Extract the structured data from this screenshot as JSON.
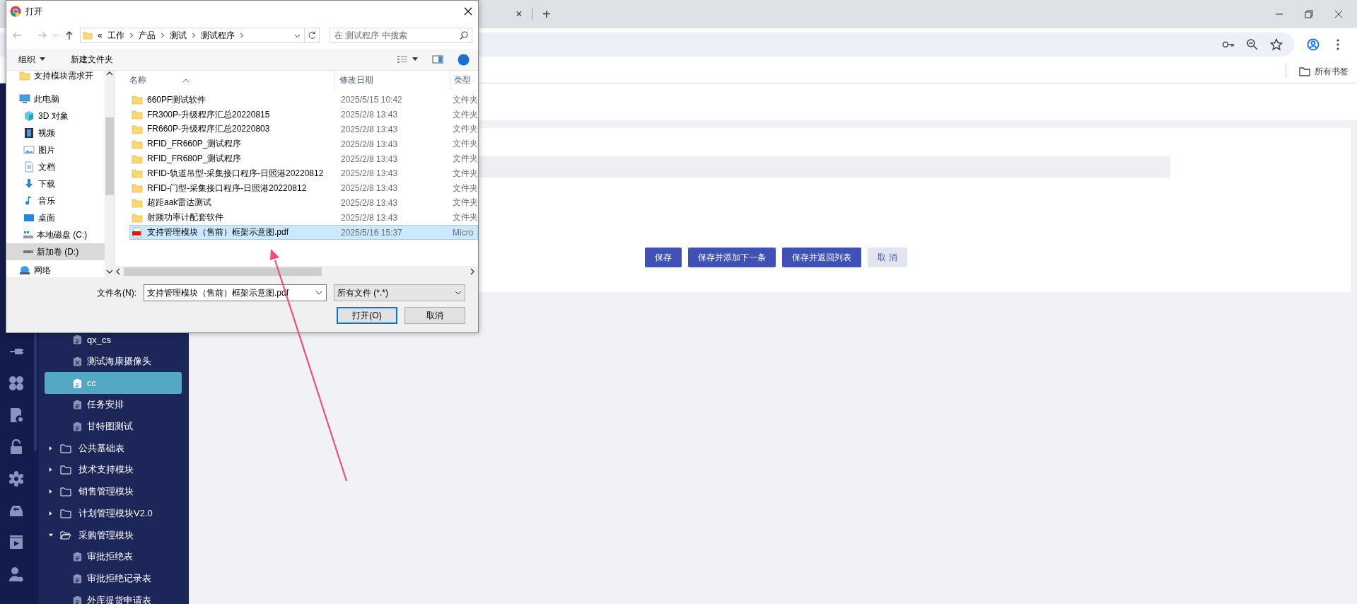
{
  "browser": {
    "tab_close": "×",
    "new_tab": "+",
    "bookmarks": "所有书签"
  },
  "dialog": {
    "title": "打开",
    "path": [
      "«",
      "工作",
      "产品",
      "测试",
      "测试程序"
    ],
    "search": {
      "placeholder": "在 测试程序 中搜索"
    },
    "toolbar": {
      "organize": "组织",
      "new_folder": "新建文件夹"
    },
    "nav": [
      {
        "label": "支持模块需求开",
        "kind": "folder",
        "selected": false
      },
      {
        "label": "此电脑",
        "kind": "pc",
        "selected": false,
        "children": [
          {
            "label": "3D 对象",
            "kind": "cube",
            "selected": false
          },
          {
            "label": "视频",
            "kind": "video",
            "selected": false
          },
          {
            "label": "图片",
            "kind": "pictures",
            "selected": false
          },
          {
            "label": "文档",
            "kind": "docs",
            "selected": false
          },
          {
            "label": "下载",
            "kind": "downloads",
            "selected": false
          },
          {
            "label": "音乐",
            "kind": "music",
            "selected": false
          },
          {
            "label": "桌面",
            "kind": "desktop",
            "selected": false
          },
          {
            "label": "本地磁盘 (C:)",
            "kind": "system-drive",
            "selected": false
          },
          {
            "label": "新加卷 (D:)",
            "kind": "drive",
            "selected": true
          }
        ]
      },
      {
        "label": "网络",
        "kind": "network",
        "selected": false
      }
    ],
    "columns": [
      "名称",
      "修改日期",
      "类型"
    ],
    "files": [
      {
        "name": "660PF测试软件",
        "date": "2025/5/15 10:42",
        "type": "文件夹",
        "kind": "folder",
        "selected": false
      },
      {
        "name": "FR300P-升级程序汇总20220815",
        "date": "2025/2/8 13:43",
        "type": "文件夹",
        "kind": "folder",
        "selected": false
      },
      {
        "name": "FR660P-升级程序汇总20220803",
        "date": "2025/2/8 13:43",
        "type": "文件夹",
        "kind": "folder",
        "selected": false
      },
      {
        "name": "RFID_FR660P_测试程序",
        "date": "2025/2/8 13:43",
        "type": "文件夹",
        "kind": "folder",
        "selected": false
      },
      {
        "name": "RFID_FR680P_测试程序",
        "date": "2025/2/8 13:43",
        "type": "文件夹",
        "kind": "folder",
        "selected": false
      },
      {
        "name": "RFID-轨道吊型-采集接口程序-日照港20220812",
        "date": "2025/2/8 13:43",
        "type": "文件夹",
        "kind": "folder",
        "selected": false
      },
      {
        "name": "RFID-门型-采集接口程序-日照港20220812",
        "date": "2025/2/8 13:43",
        "type": "文件夹",
        "kind": "folder",
        "selected": false
      },
      {
        "name": "超距aak雷达测试",
        "date": "2025/2/8 13:43",
        "type": "文件夹",
        "kind": "folder",
        "selected": false
      },
      {
        "name": "射频功率计配套软件",
        "date": "2025/2/8 13:43",
        "type": "文件夹",
        "kind": "folder",
        "selected": false
      },
      {
        "name": "支持管理模块（售前）框架示意图.pdf",
        "date": "2025/5/16 15:37",
        "type": "Micro",
        "kind": "pdf",
        "selected": true
      }
    ],
    "filename": {
      "label": "文件名(N):",
      "value": "支持管理模块（售前）框架示意图.pdf"
    },
    "filter": "所有文件 (*.*)",
    "buttons": [
      {
        "label": "打开(O)",
        "kind": "default"
      },
      {
        "label": "取消",
        "kind": "normal"
      }
    ]
  },
  "tree": [
    {
      "children": [
        {
          "label": "qx_cs",
          "kind": "doc",
          "selected": false
        },
        {
          "label": "测试海康摄像头",
          "kind": "tool",
          "selected": false
        },
        {
          "label": "cc",
          "kind": "doc",
          "selected": true
        },
        {
          "label": "任务安排",
          "kind": "doc",
          "selected": false
        },
        {
          "label": "甘特图测试",
          "kind": "doc",
          "selected": false
        }
      ]
    },
    {
      "label": "公共基础表",
      "expanded": false
    },
    {
      "label": "技术支持模块",
      "expanded": false
    },
    {
      "label": "销售管理模块",
      "expanded": false
    },
    {
      "label": "计划管理模块V2.0",
      "expanded": false
    },
    {
      "label": "采购管理模块",
      "expanded": true,
      "children": [
        {
          "label": "审批拒绝表",
          "kind": "doc",
          "selected": false
        },
        {
          "label": "审批拒绝记录表",
          "kind": "doc",
          "selected": false
        },
        {
          "label": "外库提货申请表",
          "kind": "doc",
          "selected": false
        }
      ]
    }
  ],
  "form": {
    "buttons": [
      {
        "label": "保存",
        "kind": "primary"
      },
      {
        "label": "保存并添加下一条",
        "kind": "primary"
      },
      {
        "label": "保存并返回列表",
        "kind": "primary"
      },
      {
        "label": "取 消",
        "kind": "secondary"
      }
    ]
  }
}
